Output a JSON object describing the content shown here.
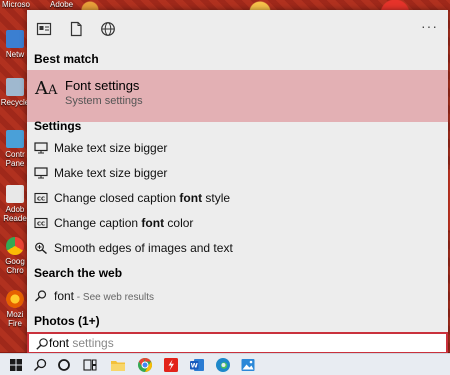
{
  "desktop": {
    "top_labels": [
      "Microso",
      "Adobe"
    ],
    "icons": [
      "Netw",
      "Recycle",
      "Contr\nPane",
      "Adob\nReade",
      "Goog\nChro",
      "Mozi\nFire"
    ]
  },
  "search": {
    "best_match_heading": "Best match",
    "best_match": {
      "title": "Font settings",
      "subtitle": "System settings",
      "icon": "font-aa-icon"
    },
    "settings_heading": "Settings",
    "settings_items": [
      {
        "pre": "Make text size bigger",
        "bold": "",
        "post": "",
        "icon": "monitor-icon"
      },
      {
        "pre": "Make text size bigger",
        "bold": "",
        "post": "",
        "icon": "monitor-icon"
      },
      {
        "pre": "Change closed caption ",
        "bold": "font",
        "post": " style",
        "icon": "cc-icon"
      },
      {
        "pre": "Change caption ",
        "bold": "font",
        "post": " color",
        "icon": "cc-icon"
      },
      {
        "pre": "Smooth edges of images and text",
        "bold": "",
        "post": "",
        "icon": "magnifier-plus-icon"
      }
    ],
    "web_heading": "Search the web",
    "web_item": {
      "query": "font",
      "suffix": " - See web results"
    },
    "photos_heading": "Photos (1+)",
    "query_typed": "font",
    "query_ghost": " settings",
    "more_glyph": "···",
    "accent_color": "#c9313c",
    "highlight_color": "#e3b0b4"
  },
  "taskbar": {
    "items": [
      "windows-start-icon",
      "search-icon",
      "cortana-icon",
      "task-view-icon",
      "file-explorer-icon",
      "chrome-icon",
      "acrobat-icon",
      "word-icon",
      "edge-icon",
      "photos-icon"
    ]
  }
}
